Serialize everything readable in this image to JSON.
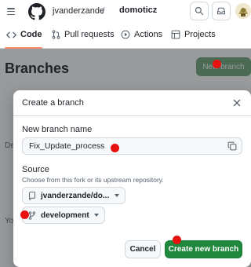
{
  "header": {
    "owner": "jvanderzande",
    "separator": "/",
    "repo": "domoticz"
  },
  "repo_nav": {
    "tabs": [
      {
        "label": "Code",
        "icon": "code-icon",
        "selected": true
      },
      {
        "label": "Pull requests",
        "icon": "git-pull-request-icon"
      },
      {
        "label": "Actions",
        "icon": "play-icon"
      },
      {
        "label": "Projects",
        "icon": "table-icon"
      }
    ]
  },
  "page": {
    "title": "Branches",
    "new_branch_label": "New branch",
    "background_fragments": [
      "De",
      "Yo"
    ]
  },
  "dialog": {
    "title": "Create a branch",
    "name_label": "New branch name",
    "name_value": "Fix_Update_process",
    "source_label": "Source",
    "source_description": "Choose from this fork or its upstream repository.",
    "repo_select": "jvanderzande/do...",
    "branch_select": "development",
    "cancel_label": "Cancel",
    "create_label": "Create new branch"
  },
  "colors": {
    "primary_green": "#1f883d",
    "marker_red": "#e8110f",
    "tab_accent": "#fd8c73"
  }
}
